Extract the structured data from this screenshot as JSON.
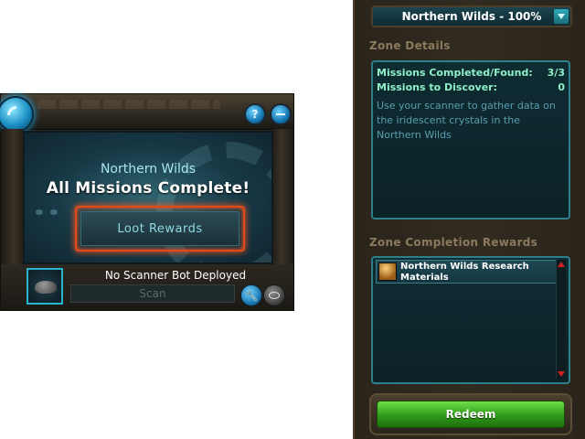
{
  "scanner": {
    "zone_name": "Northern Wilds",
    "status_headline": "All Missions Complete!",
    "loot_button_label": "Loot Rewards",
    "bot_status": "No Scanner Bot Deployed",
    "scan_placeholder": "Scan",
    "help_label": "?",
    "wrench_glyph": "🔧"
  },
  "zone_panel": {
    "zone_select_value": "Northern Wilds - 100%",
    "details_title": "Zone Details",
    "missions_completed_label": "Missions Completed/Found:",
    "missions_completed_value": "3/3",
    "missions_to_discover_label": "Missions to Discover:",
    "missions_to_discover_value": "0",
    "description": "Use your scanner to gather data on the iridescent crystals in the Northern Wilds",
    "rewards_title": "Zone Completion Rewards",
    "rewards": [
      {
        "label": "Northern Wilds Research Materials"
      }
    ],
    "redeem_label": "Redeem"
  },
  "colors": {
    "accent_teal": "#2d7f8a",
    "headline_green": "#8ef0c6",
    "loot_border": "#e0491a",
    "redeem_green": "#2f9a18",
    "scroll_arrow_red": "#d02222"
  }
}
